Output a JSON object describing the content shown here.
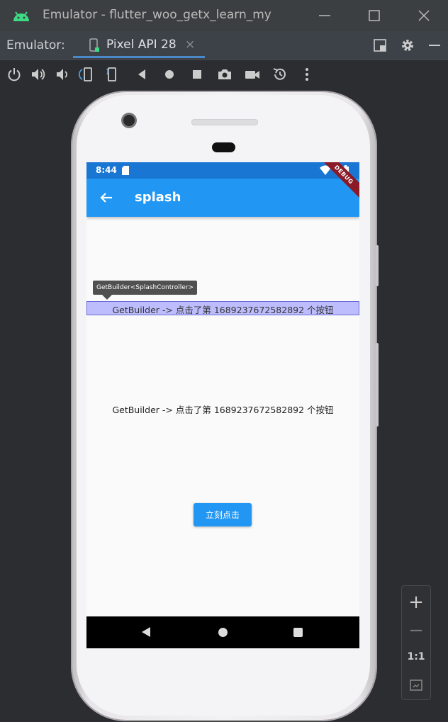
{
  "window": {
    "title": "Emulator - flutter_woo_getx_learn_my"
  },
  "tabbar": {
    "label": "Emulator:",
    "tab_label": "Pixel API 28",
    "close_glyph": "×"
  },
  "toolbar": {
    "icons": [
      "power-icon",
      "volume-up-icon",
      "volume-down-icon",
      "rotate-left-icon",
      "rotate-right-icon",
      "back-icon",
      "home-icon",
      "overview-icon",
      "screenshot-icon",
      "screen-record-icon",
      "snapshot-icon",
      "more-icon"
    ]
  },
  "device": {
    "status_time": "8:44",
    "debug_banner": "DEBUG",
    "app_title": "splash",
    "tooltip": "GetBuilder<SplashController>",
    "highlight_text": "GetBuilder -> 点击了第 1689237672582892 个按钮",
    "body_text": "GetBuilder -> 点击了第 1689237672582892 个按钮",
    "button_label": "立刻点击"
  },
  "zoom": {
    "zoom_in": "+",
    "zoom_out": "−",
    "one_to_one": "1:1"
  },
  "colors": {
    "status_bar": "#1976d2",
    "app_bar": "#2196f3",
    "debug_banner": "#8b1a26",
    "highlight": "#8080ff"
  }
}
